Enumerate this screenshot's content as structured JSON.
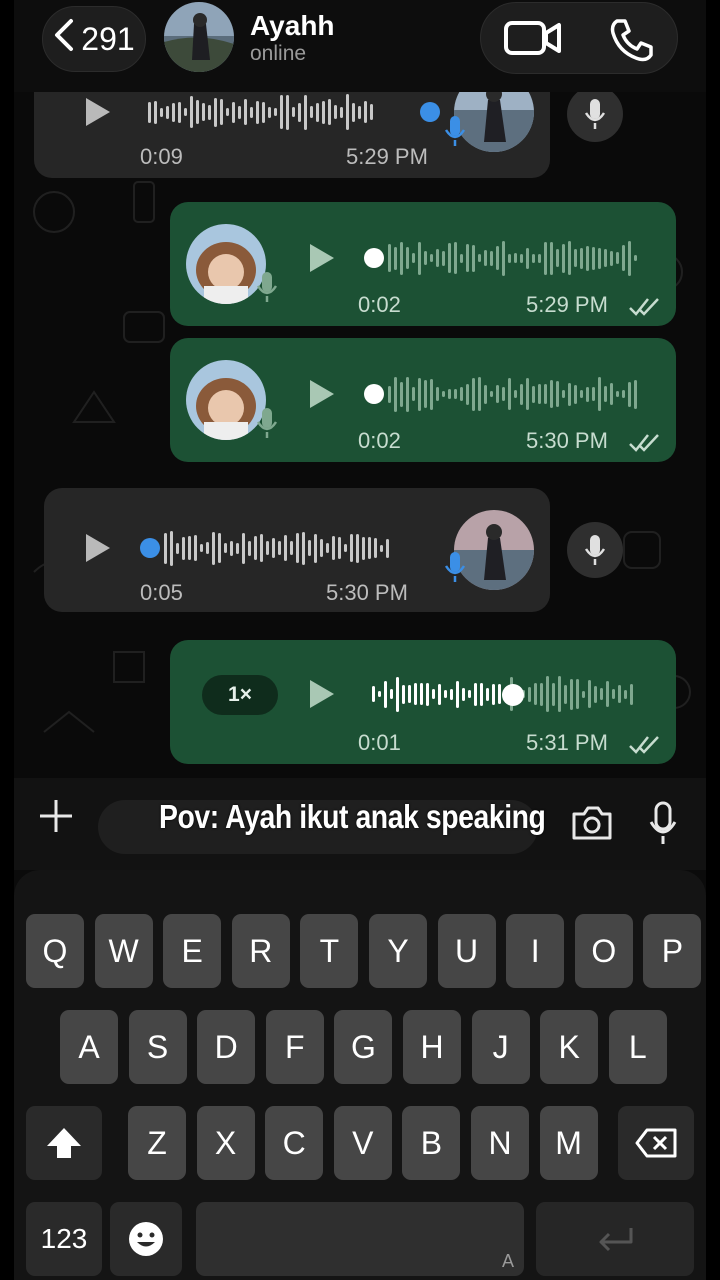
{
  "header": {
    "back_count": "291",
    "contact_name": "Ayahh",
    "status": "online"
  },
  "messages": [
    {
      "direction": "in",
      "duration": "0:09",
      "time": "5:29 PM",
      "avatar": "dad-photo"
    },
    {
      "direction": "out",
      "duration": "0:02",
      "time": "5:29 PM",
      "avatar": "daughter-photo",
      "read": true
    },
    {
      "direction": "out",
      "duration": "0:02",
      "time": "5:30 PM",
      "avatar": "daughter-photo",
      "read": true
    },
    {
      "direction": "in",
      "duration": "0:05",
      "time": "5:30 PM",
      "avatar": "dad-photo"
    },
    {
      "direction": "out",
      "duration": "0:01",
      "time": "5:31 PM",
      "speed": "1×",
      "read": true,
      "playing": true
    }
  ],
  "input": {
    "caption": "Pov: Ayah ikut anak speaking"
  },
  "keyboard": {
    "row1": [
      "Q",
      "W",
      "E",
      "R",
      "T",
      "Y",
      "U",
      "I",
      "O",
      "P"
    ],
    "row2": [
      "A",
      "S",
      "D",
      "F",
      "G",
      "H",
      "J",
      "K",
      "L"
    ],
    "row3": [
      "Z",
      "X",
      "C",
      "V",
      "B",
      "N",
      "M"
    ],
    "numbers_key": "123",
    "space_hint": "A"
  },
  "colors": {
    "outgoing_bubble": "#1c5134",
    "incoming_bubble": "#262626",
    "unplayed_dot": "#3b8fe6"
  },
  "icons": [
    "chevron-left-icon",
    "video-call-icon",
    "phone-icon",
    "play-icon",
    "mic-icon",
    "check-double-icon",
    "plus-icon",
    "camera-icon",
    "shift-icon",
    "backspace-icon",
    "emoji-icon",
    "return-icon"
  ]
}
